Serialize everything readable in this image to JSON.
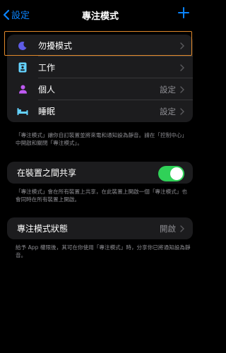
{
  "nav": {
    "back_label": "設定",
    "title": "專注模式"
  },
  "modes": [
    {
      "label": "勿擾模式",
      "value": "",
      "icon": "moon-icon",
      "color": "#5e5ce6"
    },
    {
      "label": "工作",
      "value": "",
      "icon": "id-badge-icon",
      "color": "#64d2ff"
    },
    {
      "label": "個人",
      "value": "設定",
      "icon": "person-icon",
      "color": "#bf5af2"
    },
    {
      "label": "睡眠",
      "value": "設定",
      "icon": "bed-icon",
      "color": "#64d2ff"
    }
  ],
  "modes_footer": "「專注模式」讓你自訂裝置並將來電和通知設為靜音。請在「控制中心」中開啟和關閉「專注模式」。",
  "share": {
    "label": "在裝置之間共享",
    "on": true
  },
  "share_footer": "「專注模式」會在所有裝置上共享，在此裝置上開啟一個「專注模式」也會同時在所有裝置上開啟。",
  "status": {
    "label": "專注模式狀態",
    "value": "開啟"
  },
  "status_footer": "給予 App 權限後，其可在你使用「專注模式」時，分享你已將通知設為靜音。",
  "colors": {
    "accent": "#0a84ff",
    "toggle_on": "#30d158",
    "selection": "#e0882a"
  }
}
